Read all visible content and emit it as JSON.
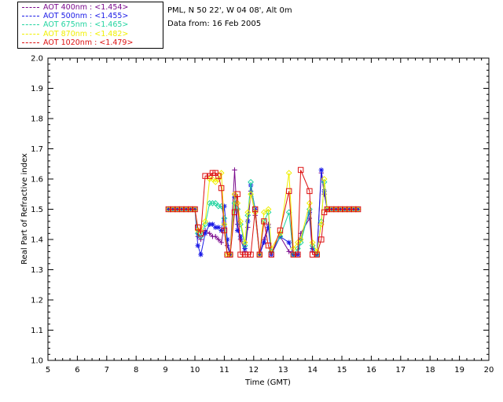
{
  "info": {
    "location": "PML, N 50 22', W 04 08', Alt 0m",
    "date": "Data from: 16 Feb 2005"
  },
  "chart_data": {
    "type": "line",
    "xlabel": "Time (GMT)",
    "ylabel": "Real Part of Refractive index",
    "xlim": [
      5,
      20
    ],
    "ylim": [
      1.0,
      2.0
    ],
    "xticks": [
      "5",
      "6",
      "7",
      "8",
      "9",
      "10",
      "11",
      "12",
      "13",
      "14",
      "15",
      "16",
      "17",
      "18",
      "19",
      "20"
    ],
    "yticks": [
      "1.0",
      "1.1",
      "1.2",
      "1.3",
      "1.4",
      "1.5",
      "1.6",
      "1.7",
      "1.8",
      "1.9",
      "2.0"
    ],
    "grid": false,
    "legend_position": "top-left outside",
    "series": [
      {
        "name": "AOT  400nm : <1.454>",
        "color": "#7a0a8c",
        "marker": "plus",
        "x": [
          9.1,
          9.25,
          9.4,
          9.55,
          9.7,
          9.85,
          10.0,
          10.1,
          10.2,
          10.35,
          10.5,
          10.6,
          10.7,
          10.8,
          10.9,
          11.0,
          11.1,
          11.2,
          11.35,
          11.45,
          11.55,
          11.7,
          11.8,
          11.9,
          12.05,
          12.2,
          12.35,
          12.5,
          12.6,
          12.9,
          13.2,
          13.35,
          13.5,
          13.6,
          13.9,
          14.0,
          14.15,
          14.3,
          14.4,
          14.5,
          14.65,
          14.8,
          14.95,
          15.1,
          15.25,
          15.4,
          15.55
        ],
        "y": [
          1.5,
          1.5,
          1.5,
          1.5,
          1.5,
          1.5,
          1.5,
          1.41,
          1.4,
          1.43,
          1.42,
          1.41,
          1.41,
          1.4,
          1.39,
          1.45,
          1.38,
          1.35,
          1.63,
          1.45,
          1.4,
          1.36,
          1.44,
          1.56,
          1.48,
          1.35,
          1.4,
          1.45,
          1.36,
          1.41,
          1.36,
          1.35,
          1.35,
          1.42,
          1.47,
          1.36,
          1.35,
          1.62,
          1.55,
          1.5,
          1.5,
          1.5,
          1.5,
          1.5,
          1.5,
          1.5,
          1.5
        ]
      },
      {
        "name": "AOT  500nm : <1.455>",
        "color": "#1a1ae6",
        "marker": "asterisk",
        "x": [
          9.1,
          9.25,
          9.4,
          9.55,
          9.7,
          9.85,
          10.0,
          10.1,
          10.2,
          10.35,
          10.5,
          10.6,
          10.7,
          10.8,
          10.9,
          11.0,
          11.1,
          11.2,
          11.35,
          11.45,
          11.55,
          11.7,
          11.8,
          11.9,
          12.05,
          12.2,
          12.35,
          12.5,
          12.6,
          12.9,
          13.2,
          13.35,
          13.5,
          13.6,
          13.9,
          14.0,
          14.15,
          14.3,
          14.4,
          14.5,
          14.65,
          14.8,
          14.95,
          15.1,
          15.25,
          15.4,
          15.55
        ],
        "y": [
          1.5,
          1.5,
          1.5,
          1.5,
          1.5,
          1.5,
          1.5,
          1.38,
          1.35,
          1.42,
          1.45,
          1.45,
          1.44,
          1.44,
          1.43,
          1.51,
          1.4,
          1.35,
          1.54,
          1.43,
          1.41,
          1.37,
          1.46,
          1.58,
          1.5,
          1.35,
          1.39,
          1.44,
          1.35,
          1.41,
          1.39,
          1.35,
          1.35,
          1.4,
          1.49,
          1.37,
          1.35,
          1.63,
          1.56,
          1.5,
          1.5,
          1.5,
          1.5,
          1.5,
          1.5,
          1.5,
          1.5
        ]
      },
      {
        "name": "AOT  675nm : <1.465>",
        "color": "#22d4a0",
        "marker": "diamond",
        "x": [
          9.1,
          9.25,
          9.4,
          9.55,
          9.7,
          9.85,
          10.0,
          10.1,
          10.2,
          10.35,
          10.5,
          10.6,
          10.7,
          10.8,
          10.9,
          11.0,
          11.1,
          11.2,
          11.35,
          11.45,
          11.55,
          11.7,
          11.8,
          11.9,
          12.05,
          12.2,
          12.35,
          12.5,
          12.6,
          12.9,
          13.2,
          13.35,
          13.5,
          13.6,
          13.9,
          14.0,
          14.15,
          14.3,
          14.4,
          14.5,
          14.65,
          14.8,
          14.95,
          15.1,
          15.25,
          15.4,
          15.55
        ],
        "y": [
          1.5,
          1.5,
          1.5,
          1.5,
          1.5,
          1.5,
          1.5,
          1.42,
          1.41,
          1.45,
          1.52,
          1.52,
          1.52,
          1.51,
          1.51,
          1.47,
          1.35,
          1.35,
          1.52,
          1.5,
          1.45,
          1.38,
          1.48,
          1.59,
          1.49,
          1.35,
          1.46,
          1.49,
          1.36,
          1.41,
          1.49,
          1.35,
          1.37,
          1.39,
          1.5,
          1.38,
          1.35,
          1.46,
          1.59,
          1.5,
          1.5,
          1.5,
          1.5,
          1.5,
          1.5,
          1.5,
          1.5
        ]
      },
      {
        "name": "AOT  870nm : <1.482>",
        "color": "#f0f000",
        "marker": "diamond",
        "x": [
          9.1,
          9.25,
          9.4,
          9.55,
          9.7,
          9.85,
          10.0,
          10.1,
          10.2,
          10.35,
          10.5,
          10.6,
          10.7,
          10.8,
          10.9,
          11.0,
          11.1,
          11.2,
          11.35,
          11.45,
          11.55,
          11.7,
          11.8,
          11.9,
          12.05,
          12.2,
          12.35,
          12.5,
          12.6,
          12.9,
          13.2,
          13.35,
          13.5,
          13.6,
          13.9,
          14.0,
          14.15,
          14.3,
          14.4,
          14.5,
          14.65,
          14.8,
          14.95,
          15.1,
          15.25,
          15.4,
          15.55
        ],
        "y": [
          1.5,
          1.5,
          1.5,
          1.5,
          1.5,
          1.5,
          1.5,
          1.43,
          1.43,
          1.46,
          1.6,
          1.6,
          1.59,
          1.6,
          1.62,
          1.45,
          1.35,
          1.35,
          1.55,
          1.52,
          1.46,
          1.39,
          1.49,
          1.55,
          1.49,
          1.35,
          1.49,
          1.5,
          1.37,
          1.42,
          1.62,
          1.37,
          1.39,
          1.4,
          1.52,
          1.39,
          1.36,
          1.45,
          1.6,
          1.5,
          1.5,
          1.5,
          1.5,
          1.5,
          1.5,
          1.5,
          1.5
        ]
      },
      {
        "name": "AOT 1020nm : <1.479>",
        "color": "#dd1111",
        "marker": "square",
        "x": [
          9.1,
          9.25,
          9.4,
          9.55,
          9.7,
          9.85,
          10.0,
          10.1,
          10.2,
          10.35,
          10.5,
          10.6,
          10.7,
          10.8,
          10.9,
          11.0,
          11.1,
          11.2,
          11.35,
          11.45,
          11.55,
          11.7,
          11.8,
          11.9,
          12.05,
          12.2,
          12.35,
          12.5,
          12.6,
          12.9,
          13.2,
          13.35,
          13.5,
          13.6,
          13.9,
          14.0,
          14.15,
          14.3,
          14.4,
          14.5,
          14.65,
          14.8,
          14.95,
          15.1,
          15.25,
          15.4,
          15.55
        ],
        "y": [
          1.5,
          1.5,
          1.5,
          1.5,
          1.5,
          1.5,
          1.5,
          1.44,
          1.42,
          1.61,
          1.61,
          1.62,
          1.62,
          1.61,
          1.57,
          1.43,
          1.35,
          1.35,
          1.49,
          1.55,
          1.35,
          1.35,
          1.35,
          1.35,
          1.5,
          1.35,
          1.46,
          1.38,
          1.35,
          1.43,
          1.56,
          1.35,
          1.35,
          1.63,
          1.56,
          1.35,
          1.35,
          1.4,
          1.49,
          1.5,
          1.5,
          1.5,
          1.5,
          1.5,
          1.5,
          1.5,
          1.5
        ]
      }
    ]
  }
}
